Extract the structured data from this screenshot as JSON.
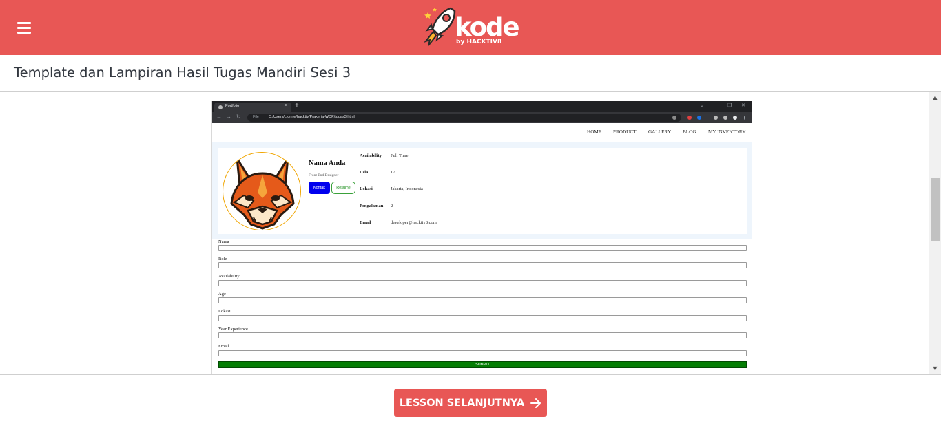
{
  "header": {
    "logo_word": "kode",
    "logo_sub": "by HACKTIV8"
  },
  "page": {
    "title": "Template dan Lampiran Hasil Tugas Mandiri Sesi 3"
  },
  "browser": {
    "tab_title": "Portfolio",
    "tab_close": "×",
    "new_tab": "+",
    "file_label": "File",
    "url": "C:/Users/Lionne/hacktiv/Prakerja-WDP/tugas3.html"
  },
  "site_nav": [
    "HOME",
    "PRODUCT",
    "GALLERY",
    "BLOG",
    "MY INVENTORY"
  ],
  "profile": {
    "name": "Nama Anda",
    "role": "Front End Designer",
    "kontak_label": "Kontak",
    "resume_label": "Resume",
    "info": [
      {
        "key": "Availability",
        "value": "Full Time"
      },
      {
        "key": "Usia",
        "value": "17"
      },
      {
        "key": "Lokasi",
        "value": "Jakarta, Indonesia"
      },
      {
        "key": "Pengalaman",
        "value": "2"
      },
      {
        "key": "Email",
        "value": "developer@hacktiv8.com"
      }
    ]
  },
  "form": {
    "fields": [
      "Nama",
      "Role",
      "Availability",
      "Age",
      "Lokasi",
      "Year Experience",
      "Email"
    ],
    "submit_label": "SUBMIT"
  },
  "footer": {
    "next_label": "LESSON SELANJUTNYA"
  },
  "colors": {
    "brand": "#e85755",
    "kontak": "#0000ee",
    "submit": "#047d04"
  }
}
